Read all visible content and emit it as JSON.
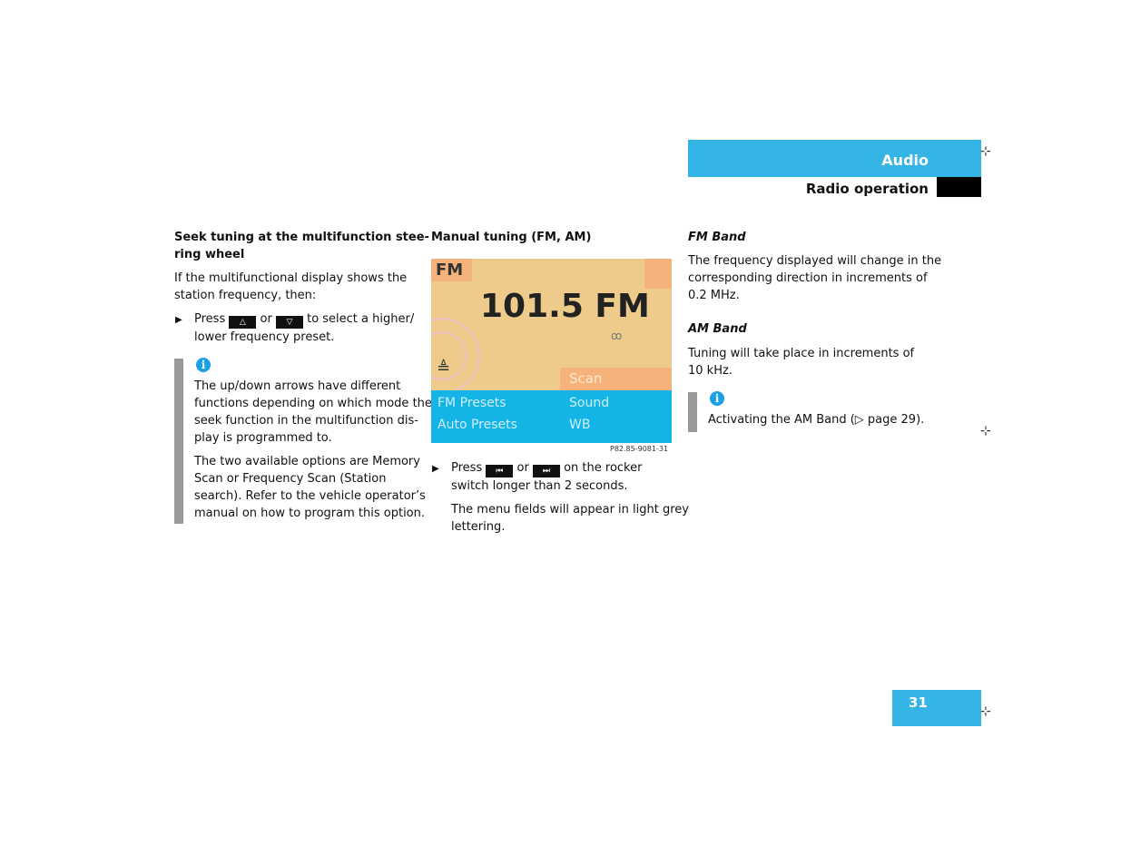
{
  "header": {
    "section": "Audio",
    "subsection": "Radio operation"
  },
  "page_number": "31",
  "col1": {
    "title": "Seek tuning at the multifunction stee-ring wheel",
    "title_l1": "Seek tuning at the multifunction stee-",
    "title_l2": "ring wheel",
    "intro_l1": "If the multifunctional display shows the",
    "intro_l2": "station frequency, then:",
    "step_press": "Press",
    "step_or": "or",
    "step_rest": "to select a higher/",
    "step_l2": "lower frequency preset.",
    "note_lines": [
      "The up/down arrows have different",
      "functions depending on which mode the",
      "seek function in the multifunction dis-",
      "play is programmed to."
    ],
    "note2_lines": [
      "The two available options are Memory",
      "Scan or Frequency Scan (Station",
      "search). Refer to the vehicle operator’s",
      "manual on how to program this option."
    ]
  },
  "col2": {
    "title": "Manual tuning (FM, AM)",
    "display": {
      "band": "FM",
      "frequency": "101.5 FM",
      "scan": "Scan",
      "menu": [
        "FM Presets",
        "Sound",
        "Auto Presets",
        "WB"
      ]
    },
    "figure_id": "P82.85-9081-31",
    "step_press": "Press",
    "step_or": "or",
    "step_rest": "on the rocker",
    "step_l2": "switch longer than 2 seconds.",
    "note_l1": "The menu fields will appear in light grey",
    "note_l2": "lettering."
  },
  "col3": {
    "fm_title": "FM Band",
    "fm_lines": [
      "The frequency displayed will change in the",
      "corresponding direction in increments of",
      "0.2 MHz."
    ],
    "am_title": "AM Band",
    "am_lines": [
      "Tuning will take place in increments of",
      "10 kHz."
    ],
    "info_text": "Activating the AM Band (▷ page 29)."
  },
  "colors": {
    "accent": "#35b4e6",
    "info": "#1aa0e6"
  }
}
